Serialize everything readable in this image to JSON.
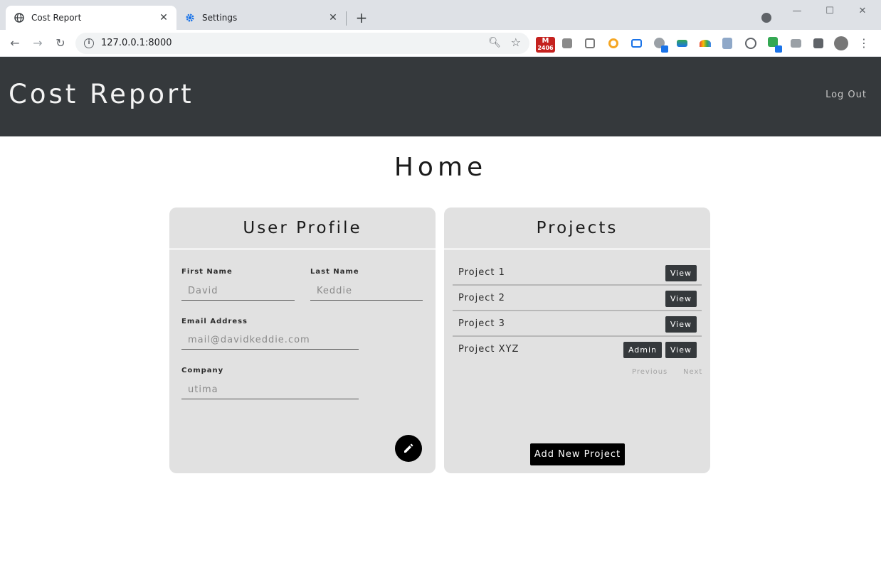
{
  "browser": {
    "tabs": [
      {
        "title": "Cost Report",
        "icon": "globe-icon"
      },
      {
        "title": "Settings",
        "icon": "gear-icon"
      }
    ],
    "url": "127.0.0.1:8000",
    "extensions": {
      "mail_badge_count": "2406"
    }
  },
  "navbar": {
    "brand": "Cost Report",
    "logout_label": "Log Out"
  },
  "page": {
    "title": "Home"
  },
  "profile": {
    "title": "User Profile",
    "first_name": {
      "label": "First Name",
      "value": "David"
    },
    "last_name": {
      "label": "Last Name",
      "value": "Keddie"
    },
    "email": {
      "label": "Email Address",
      "value": "mail@davidkeddie.com"
    },
    "company": {
      "label": "Company",
      "value": "utima"
    },
    "edit_icon": "pencil-icon"
  },
  "projects": {
    "title": "Projects",
    "items": [
      {
        "name": "Project 1",
        "view_label": "View"
      },
      {
        "name": "Project 2",
        "view_label": "View"
      },
      {
        "name": "Project 3",
        "view_label": "View"
      },
      {
        "name": "Project XYZ",
        "admin_label": "Admin",
        "view_label": "View"
      }
    ],
    "pager": {
      "previous": "Previous",
      "next": "Next"
    },
    "add_label": "Add New Project"
  },
  "colors": {
    "navbar_bg": "#35393c",
    "card_bg": "#e1e1e1",
    "dark_button": "#35393c",
    "primary_button": "#000000"
  }
}
